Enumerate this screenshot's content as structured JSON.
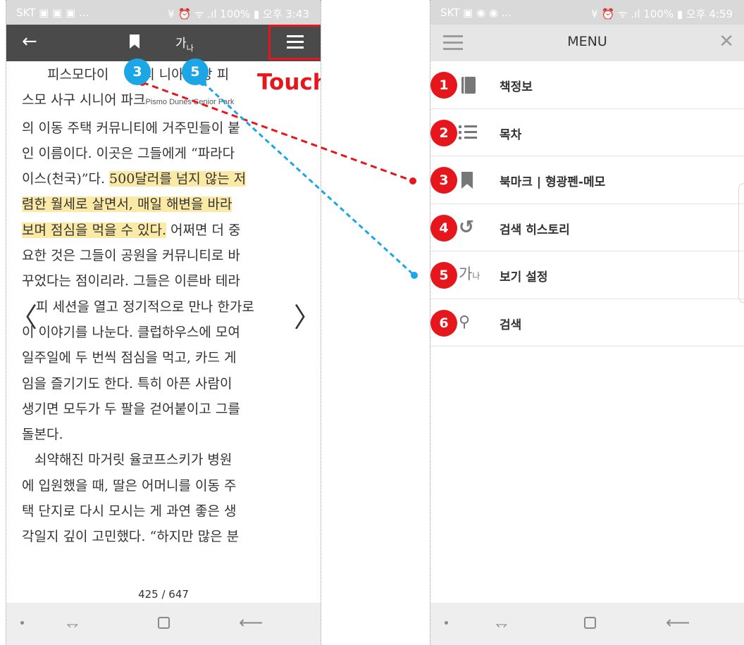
{
  "left_phone": {
    "status": {
      "carrier": "SKT ▣ ▣ ▣ ...",
      "right": "¥ ⏰ ᯤ .ıl 100% ▮ 오후 3:43"
    },
    "toolbar": {
      "font_label": "가",
      "font_sub": "나"
    },
    "reader_lines": [
      "피스모다이",
      "스모 사구 시니어 파크",
      "의 이동 주택 커뮤니티에 거주민들이 붙",
      "인 이름이다. 이곳은 그들에게 “파라다",
      "이스(천국)”다.",
      "렴한 월세로 살면서, 매일 해변을 바라",
      "보며 점심을 먹을 수 있다.",
      "요한 것은 그들이 공원을 커뮤니티로 바",
      "꾸었다는 점이리라. 그들은 이른바 테라",
      "피 세션을 열고 정기적으로 만나 한가로",
      "이 이야기를 나눈다. 클럽하우스에 모여",
      "일주일에 두 번씩 점심을 먹고, 카드 게",
      "임을 즐기기도 한다. 특히 아픈 사람이",
      "생기면 모두가 두 팔을 걷어붙이고 그를",
      "돌본다.",
      "쇠약해진 마거릿 율코프스키가 병원",
      "에 입원했을 때, 딸은 어머니를 이동 주",
      "택 단지로 다시 모시는 게 과연 좋은 생",
      "각일지 깊이 고민했다. “하지만 많은 분"
    ],
    "line0_tail": "캘리    니아 중앙 피",
    "english_name": "Pismo Dunes Senior Park",
    "hl_line4": "500달러를 넘지 않는 저",
    "tail_line6": "어쩌면 더 중",
    "prev_arrow": "〈",
    "next_arrow": "〉",
    "page_number": "425 / 647",
    "touch_label": "Touch!",
    "badge_3": "3",
    "badge_5": "5"
  },
  "right_phone": {
    "status": {
      "carrier": "SKT ▣ ◉ ◉ ...",
      "right": "¥ ⏰ ᯤ .ıl 100% ▮ 오후 4:59"
    },
    "menu_title": "MENU",
    "close": "✕",
    "items": [
      {
        "num": "1",
        "label": "책정보",
        "icon": "book-icon"
      },
      {
        "num": "2",
        "label": "목차",
        "icon": "list-icon"
      },
      {
        "num": "3",
        "label": "북마크 | 형광펜-메모",
        "icon": "bookmark-icon"
      },
      {
        "num": "4",
        "label": "검색 히스토리",
        "icon": "history-icon"
      },
      {
        "num": "5",
        "label": "보기 설정",
        "icon": "font-size-icon"
      },
      {
        "num": "6",
        "label": "검색",
        "icon": "search-icon"
      }
    ]
  },
  "navbar": {
    "recent": "⥐",
    "back": "⟵"
  },
  "colors": {
    "accent_red": "#e5171d",
    "accent_blue": "#1ca6e6",
    "appbar": "#4a4a4a",
    "highlight": "#fbe9a6"
  }
}
